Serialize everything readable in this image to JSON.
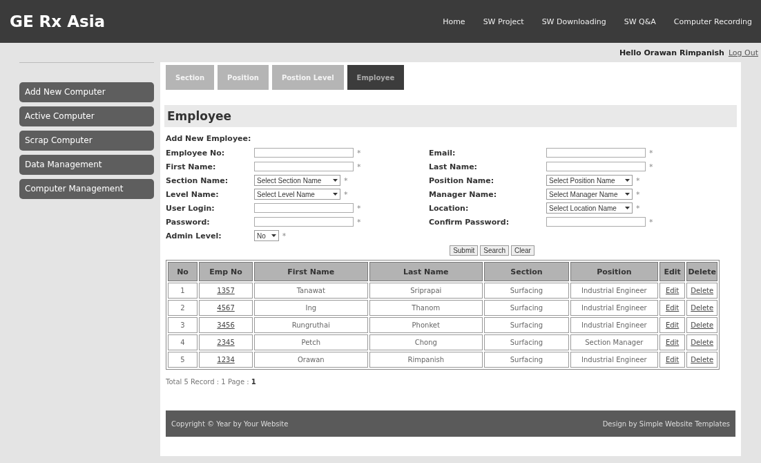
{
  "header": {
    "logo": "GE Rx Asia",
    "nav": [
      {
        "label": "Home",
        "selected": false
      },
      {
        "label": "SW Project",
        "selected": false
      },
      {
        "label": "SW Downloading",
        "selected": false
      },
      {
        "label": "SW Q&A",
        "selected": false
      },
      {
        "label": "Computer Recording",
        "selected": false
      }
    ]
  },
  "user_bar": {
    "greeting": "Hello Orawan Rimpanish",
    "logout": "Log Out"
  },
  "sidebar": {
    "items": [
      {
        "label": "Add New Computer",
        "selected": false
      },
      {
        "label": "Active Computer",
        "selected": false
      },
      {
        "label": "Scrap Computer",
        "selected": false
      },
      {
        "label": "Data Management",
        "selected": false
      },
      {
        "label": "Computer Management",
        "selected": false
      }
    ]
  },
  "tabs": [
    {
      "label": "Section",
      "selected": false
    },
    {
      "label": "Position",
      "selected": false
    },
    {
      "label": "Postion Level",
      "selected": false
    },
    {
      "label": "Employee",
      "selected": true
    }
  ],
  "page_title": "Employee",
  "form": {
    "heading": "Add New Employee:",
    "left": [
      {
        "label": "Employee No:",
        "kind": "text",
        "required": "*"
      },
      {
        "label": "First Name:",
        "kind": "text",
        "required": "*"
      },
      {
        "label": "Section Name:",
        "kind": "select",
        "value": "Select Section Name",
        "required": "*"
      },
      {
        "label": "Level Name:",
        "kind": "select",
        "value": "Select Level Name",
        "required": "*"
      },
      {
        "label": "User Login:",
        "kind": "text",
        "required": "*"
      },
      {
        "label": "Password:",
        "kind": "text",
        "required": "*"
      },
      {
        "label": "Admin Level:",
        "kind": "select",
        "value": "No",
        "required": "*"
      }
    ],
    "right": [
      {
        "label": "Email:",
        "kind": "text",
        "required": "*"
      },
      {
        "label": "Last Name:",
        "kind": "text",
        "required": "*"
      },
      {
        "label": "Position Name:",
        "kind": "select",
        "value": "Select Position Name",
        "required": "*"
      },
      {
        "label": "Manager Name:",
        "kind": "select",
        "value": "Select Manager Name",
        "required": "*"
      },
      {
        "label": "Location:",
        "kind": "select",
        "value": "Select Location Name",
        "required": "*"
      },
      {
        "label": "Confirm Password:",
        "kind": "text",
        "required": "*"
      }
    ],
    "buttons": [
      "Submit",
      "Search",
      "Clear"
    ]
  },
  "table": {
    "columns": [
      "No",
      "Emp No",
      "First Name",
      "Last Name",
      "Section",
      "Position",
      "Edit",
      "Delete"
    ],
    "rows": [
      {
        "no": "1",
        "emp_no": "1357",
        "first_name": "Tanawat",
        "last_name": "Sriprapai",
        "section": "Surfacing",
        "position": "Industrial Engineer",
        "edit": "Edit",
        "delete": "Delete"
      },
      {
        "no": "2",
        "emp_no": "4567",
        "first_name": "Ing",
        "last_name": "Thanom",
        "section": "Surfacing",
        "position": "Industrial Engineer",
        "edit": "Edit",
        "delete": "Delete"
      },
      {
        "no": "3",
        "emp_no": "3456",
        "first_name": "Rungruthai",
        "last_name": "Phonket",
        "section": "Surfacing",
        "position": "Industrial Engineer",
        "edit": "Edit",
        "delete": "Delete"
      },
      {
        "no": "4",
        "emp_no": "2345",
        "first_name": "Petch",
        "last_name": "Chong",
        "section": "Surfacing",
        "position": "Section Manager",
        "edit": "Edit",
        "delete": "Delete"
      },
      {
        "no": "5",
        "emp_no": "1234",
        "first_name": "Orawan",
        "last_name": "Rimpanish",
        "section": "Surfacing",
        "position": "Industrial Engineer",
        "edit": "Edit",
        "delete": "Delete"
      }
    ]
  },
  "pagination": "Total 5 Record : 1 Page : **1**",
  "footer": {
    "copyright": "Copyright © Year by Your Website",
    "credit": "Design by Simple Website Templates"
  }
}
